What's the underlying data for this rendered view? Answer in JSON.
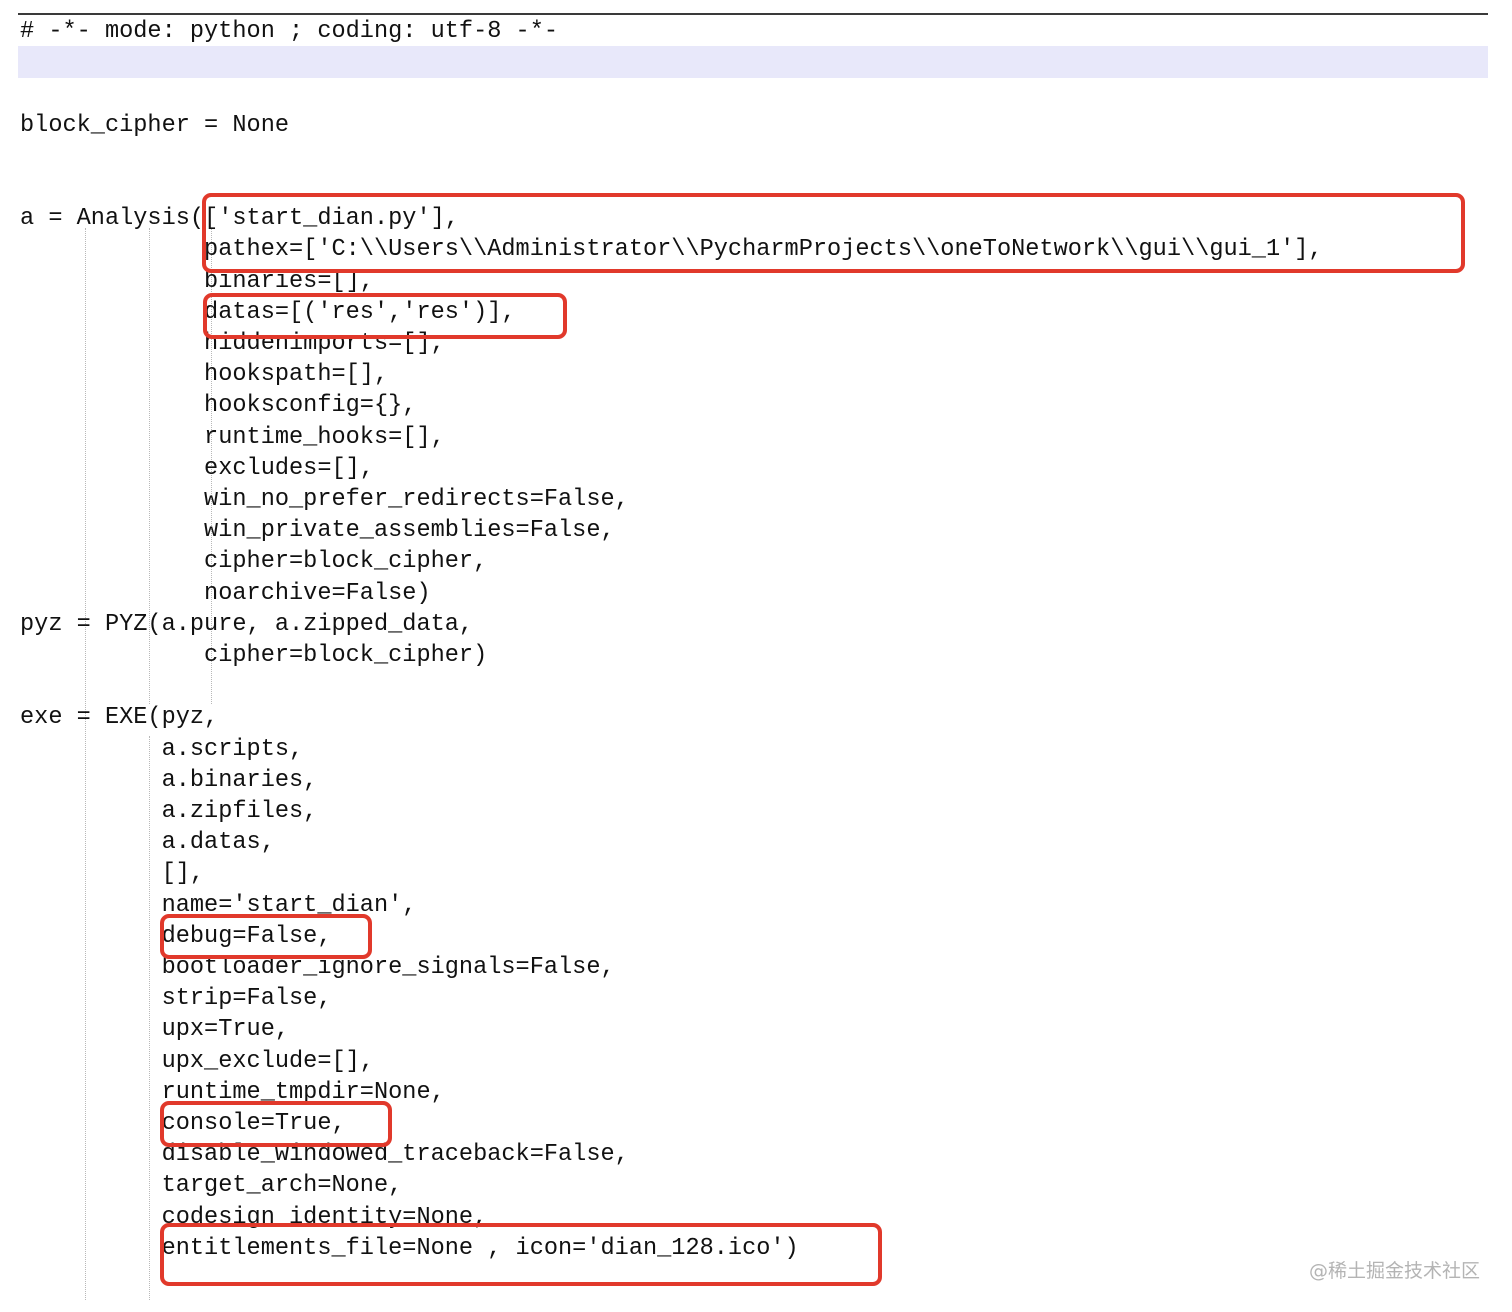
{
  "editor": {
    "lines": [
      "# -*- mode: python ; coding: utf-8 -*-",
      "",
      "",
      "block_cipher = None",
      "",
      "",
      "a = Analysis(['start_dian.py'],",
      "             pathex=['C:\\\\Users\\\\Administrator\\\\PycharmProjects\\\\oneToNetwork\\\\gui\\\\gui_1'],",
      "             binaries=[],",
      "             datas=[('res','res')],",
      "             hiddenimports=[],",
      "             hookspath=[],",
      "             hooksconfig={},",
      "             runtime_hooks=[],",
      "             excludes=[],",
      "             win_no_prefer_redirects=False,",
      "             win_private_assemblies=False,",
      "             cipher=block_cipher,",
      "             noarchive=False)",
      "pyz = PYZ(a.pure, a.zipped_data,",
      "             cipher=block_cipher)",
      "",
      "exe = EXE(pyz,",
      "          a.scripts,",
      "          a.binaries,",
      "          a.zipfiles,",
      "          a.datas,",
      "          [],",
      "          name='start_dian',",
      "          debug=False,",
      "          bootloader_ignore_signals=False,",
      "          strip=False,",
      "          upx=True,",
      "          upx_exclude=[],",
      "          runtime_tmpdir=None,",
      "          console=True,",
      "          disable_windowed_traceback=False,",
      "          target_arch=None,",
      "          codesign_identity=None,",
      "          entitlements_file=None , icon='dian_128.ico')"
    ]
  },
  "annotations": {
    "highlight_color": "#e1392b"
  },
  "watermark": "@稀土掘金技术社区"
}
